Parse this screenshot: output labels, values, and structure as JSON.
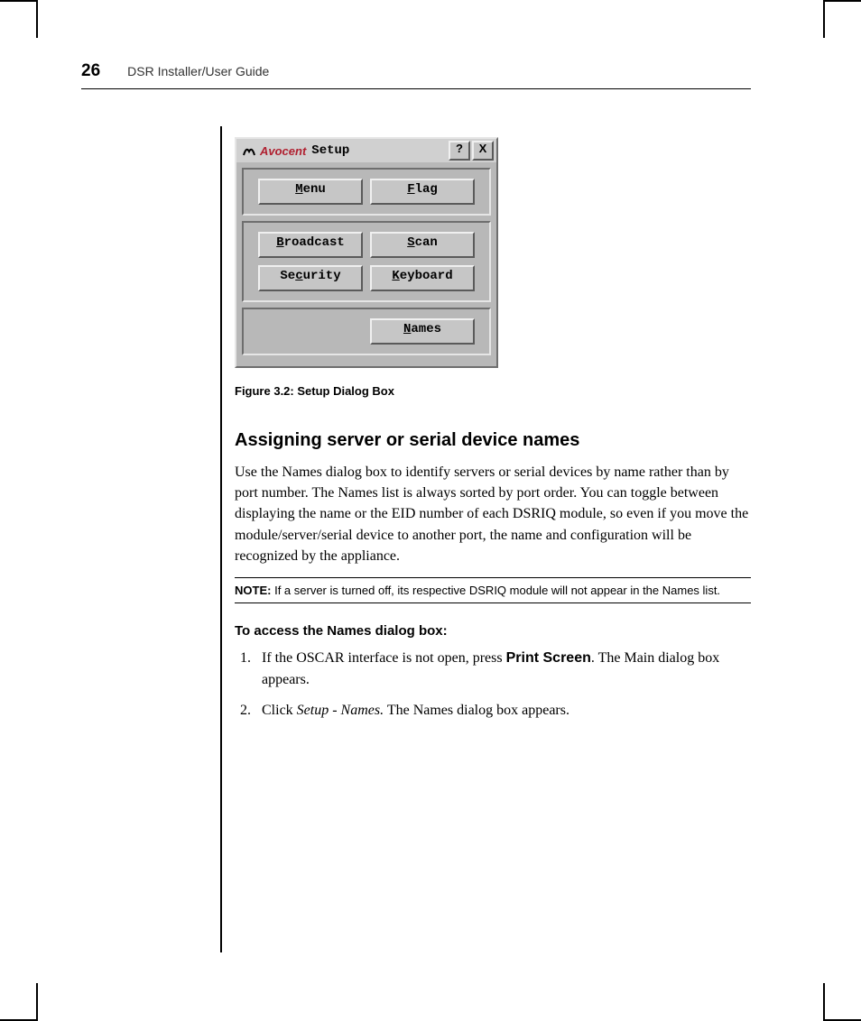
{
  "page": {
    "number": "26",
    "running_title": "DSR Installer/User Guide"
  },
  "dialog": {
    "brand": "Avocent",
    "title": "Setup",
    "help_glyph": "?",
    "close_glyph": "X",
    "buttons": {
      "menu": "Menu",
      "flag": "Flag",
      "broadcast": "Broadcast",
      "scan": "Scan",
      "security": "Security",
      "keyboard": "Keyboard",
      "names": "Names"
    }
  },
  "figure_caption": "Figure 3.2: Setup Dialog Box",
  "section_heading": "Assigning server or serial device names",
  "section_body": "Use the Names dialog box to identify servers or serial devices by name rather than by port number. The Names list is always sorted by port order. You can toggle between displaying the name or the EID number of each DSRIQ module, so even if you move the module/server/serial device to another port, the name and configuration will be recognized by the appliance.",
  "note": {
    "label": "NOTE:",
    "text": "If a server is turned off, its respective DSRIQ module will not appear in the Names list."
  },
  "procedure_heading": "To access the Names dialog box:",
  "steps": {
    "s1_a": "If the OSCAR interface is not open, press ",
    "s1_kbd": "Print Screen",
    "s1_b": ". The Main dialog box appears.",
    "s2_a": "Click ",
    "s2_ital": "Setup - Names.",
    "s2_b": " The Names dialog box appears."
  }
}
